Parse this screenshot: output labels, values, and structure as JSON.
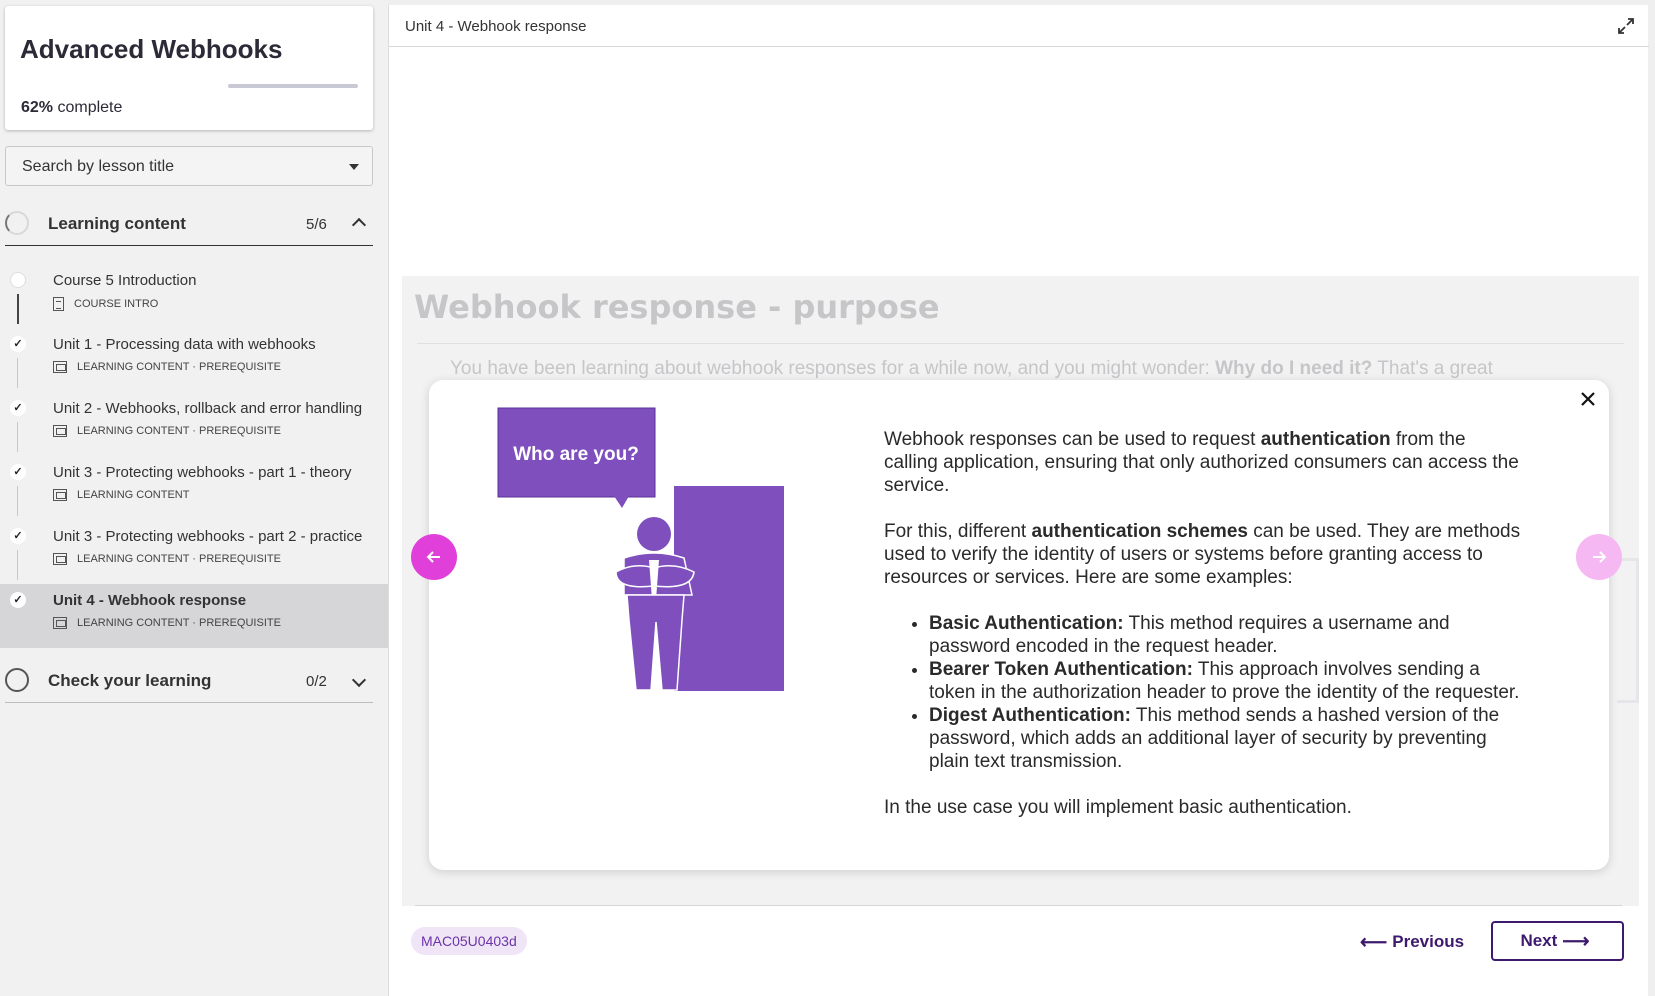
{
  "course": {
    "title": "Advanced Webhooks",
    "progress_percent": "62%",
    "progress_suffix": " complete",
    "progress_fraction": 0.62
  },
  "search": {
    "placeholder": "Search by lesson title"
  },
  "sections": {
    "learning": {
      "title": "Learning content",
      "count": "5/6"
    },
    "check": {
      "title": "Check your learning",
      "count": "0/2"
    }
  },
  "lessons": [
    {
      "title": "Course 5 Introduction",
      "meta": "COURSE INTRO",
      "done": false
    },
    {
      "title": "Unit 1 - Processing data with webhooks",
      "meta": "LEARNING CONTENT · PREREQUISITE",
      "done": true
    },
    {
      "title": "Unit 2 - Webhooks, rollback and error handling",
      "meta": "LEARNING CONTENT · PREREQUISITE",
      "done": true
    },
    {
      "title": "Unit 3 - Protecting webhooks - part 1 - theory",
      "meta": "LEARNING CONTENT",
      "done": true
    },
    {
      "title": "Unit 3 - Protecting webhooks - part 2 - practice",
      "meta": "LEARNING CONTENT · PREREQUISITE",
      "done": true
    },
    {
      "title": "Unit 4 - Webhook response",
      "meta": "LEARNING CONTENT · PREREQUISITE",
      "done": true,
      "active": true
    }
  ],
  "header": {
    "title": "Unit 4 - Webhook response"
  },
  "page": {
    "ghost_title": "Webhook response - purpose",
    "ghost_para_1": "You have been learning about webhook responses for a while now, and you might wonder: ",
    "ghost_para_bold": "Why do I need it?",
    "ghost_para_2": " That's a great"
  },
  "modal": {
    "illustration_bubble": "Who are you?",
    "p1_a": "Webhook responses can be used to request ",
    "p1_bold": "authentication",
    "p1_b": " from the calling application, ensuring that only authorized consumers can access the service.",
    "p2_a": "For this, different ",
    "p2_bold": "authentication schemes",
    "p2_b": " can be used. They are methods used to verify the identity of users or systems before granting access to resources or services. Here are some examples:",
    "bullets": [
      {
        "bold": "Basic Authentication:",
        "text": " This method requires a username and password encoded in the request header."
      },
      {
        "bold": "Bearer Token Authentication:",
        "text": " This approach involves sending a token in the authorization header to prove the identity of the requester."
      },
      {
        "bold": "Digest Authentication:",
        "text": " This method sends a hashed version of the password, which adds an additional layer of security by preventing plain text transmission."
      }
    ],
    "p3": "In the use case you will implement basic authentication."
  },
  "footer": {
    "code": "MAC05U0403d",
    "previous_label": "Previous",
    "next_label": "Next"
  },
  "colors": {
    "accent_purple": "#7e4fbd",
    "nav_pink": "#e040d9",
    "nav_pink_light": "#f6b8f2",
    "button_purple": "#3e1a6e"
  },
  "icons": {
    "expand": "expand-icon",
    "close": "close-icon",
    "dropdown": "caret-down-icon",
    "check": "check-icon"
  }
}
